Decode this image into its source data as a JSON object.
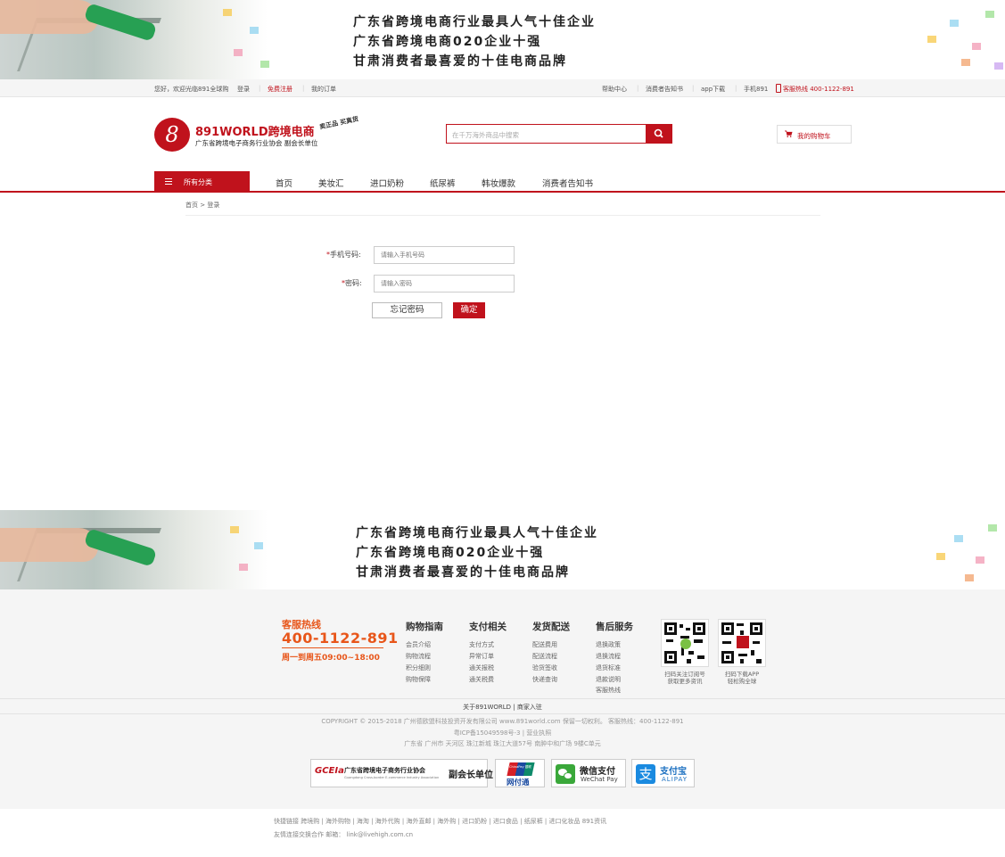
{
  "banner": {
    "lines": [
      "广东省跨境电商行业最具人气十佳企业",
      "广东省跨境电商020企业十强",
      "甘肃消费者最喜爱的十佳电商品牌"
    ]
  },
  "topbar": {
    "welcome": "您好，欢迎光临891全球购",
    "login": "登录",
    "register": "免费注册",
    "orders": "我的订单",
    "help": "帮助中心",
    "notice": "消费者告知书",
    "app": "app下载",
    "mobile": "手机891",
    "hotline": "客服热线 400-1122-891"
  },
  "header": {
    "logo_mark": "8",
    "logo_title": "891WORLD跨境电商",
    "logo_sub": "广东省跨境电子商务行业协会    副会长单位",
    "logo_stamp": "卖正品 买真货",
    "search_placeholder": "在千万海外商品中搜索",
    "cart_label": "我的购物车"
  },
  "nav": {
    "category": "所有分类",
    "items": [
      "首页",
      "美妆汇",
      "进口奶粉",
      "纸尿裤",
      "韩妆爆款",
      "消费者告知书"
    ]
  },
  "breadcrumb": "首页 > 登录",
  "form": {
    "phone_label": "手机号码:",
    "phone_placeholder": "请输入手机号码",
    "password_label": "密码:",
    "password_placeholder": "请输入密码",
    "forgot_label": "忘记密码",
    "submit_label": "确定",
    "required_mark": "*"
  },
  "footer": {
    "hotline_title": "客服热线",
    "hotline_number": "400-1122-891",
    "hotline_time": "周一到周五09:00~18:00",
    "columns": [
      {
        "title": "购物指南",
        "links": [
          "会员介绍",
          "购物流程",
          "积分细则",
          "购物保障"
        ]
      },
      {
        "title": "支付相关",
        "links": [
          "支付方式",
          "异常订单",
          "通关报税",
          "通关税费"
        ]
      },
      {
        "title": "发货配送",
        "links": [
          "配送费用",
          "配送流程",
          "验货签收",
          "快递查询"
        ]
      },
      {
        "title": "售后服务",
        "links": [
          "退换政策",
          "退换流程",
          "退货标准",
          "退款说明",
          "客服热线"
        ]
      }
    ],
    "qr1_caption": [
      "扫码关注订阅号",
      "获取更多资讯"
    ],
    "qr2_caption": [
      "扫码下载APP",
      "轻松购全球"
    ],
    "about": "关于891WORLD | 商家入驻",
    "copyright": "COPYRIGHT © 2015-2018 广州德欧盟科技投资开发有限公司 www.891world.com 保留一切权利。 客服热线：400-1122-891",
    "icp": "粤ICP备15049598号-3 | 营业执照",
    "address": "广东省 广州市 天河区 珠江新城 珠江大道57号 南肿中和广场 9楼C单元",
    "badges": {
      "gcea_title": "广东省跨境电子商务行业协会",
      "gcea_sub": "Guangdong Cross-border E-commerce Industry Association",
      "gcea_role": "副会长单位",
      "gcea_logo": "GCEIa",
      "unionpay": "网付通",
      "unionpay_top": "ChinaPay 银联",
      "wechat": "微信支付",
      "wechat_en": "WeChat Pay",
      "alipay": "支付宝",
      "alipay_en": "ALIPAY"
    },
    "quick_links": "快捷链接   跨境购 | 海外购物 | 海淘 | 海外代购 | 海外直邮 | 海外购 | 进口奶粉 | 进口食品 | 纸尿裤 | 进口化妆品   891资讯",
    "friend_links": "友情连接交换合作    邮箱：   link@livehigh.com.cn"
  },
  "colors": {
    "brand": "#c0121c",
    "hotline": "#e8561a"
  }
}
